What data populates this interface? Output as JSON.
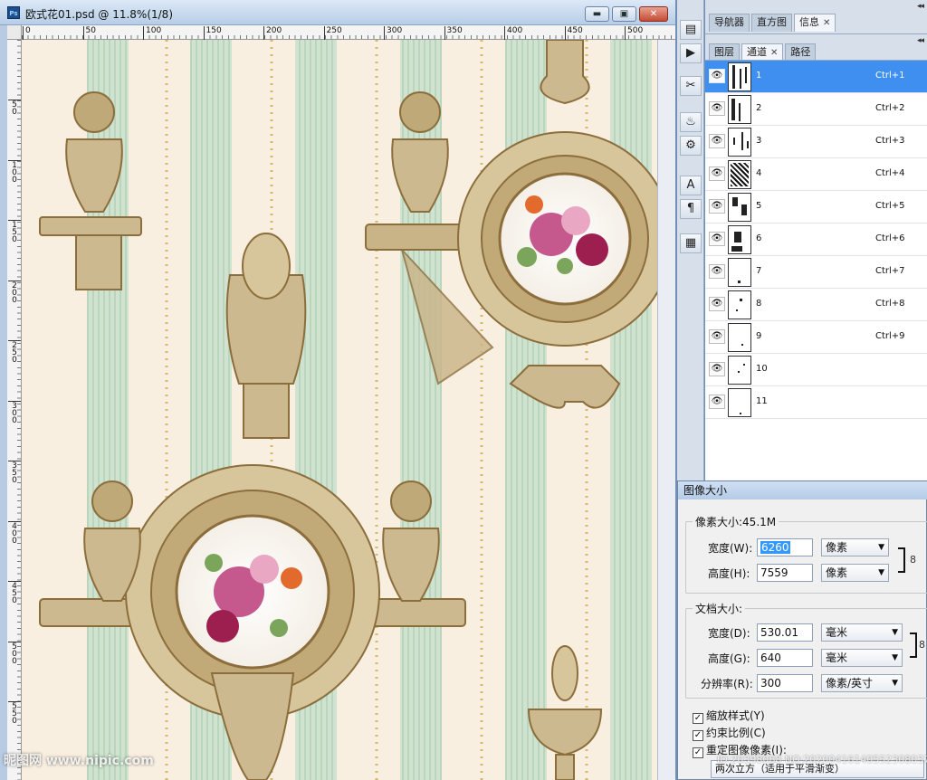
{
  "document": {
    "title": "欧式花01.psd @ 11.8%(1/8)",
    "app_badge": "Ps",
    "window_controls": {
      "minimize": "▬",
      "maximize": "▣",
      "close": "✕"
    },
    "ruler_top_ticks": [
      "0",
      "50",
      "100",
      "150",
      "200",
      "250",
      "300",
      "350",
      "400",
      "450",
      "500"
    ],
    "ruler_left_ticks": [
      "5\n0",
      "1\n0\n0",
      "1\n5\n0",
      "2\n0\n0",
      "2\n5\n0",
      "3\n0\n0",
      "3\n5\n0",
      "4\n0\n0",
      "4\n5\n0",
      "5\n0\n0",
      "5\n5\n0"
    ]
  },
  "panels": {
    "top_tabs": [
      {
        "label": "导航器"
      },
      {
        "label": "直方图"
      },
      {
        "label": "信息",
        "active": true
      }
    ],
    "mid_tabs": [
      {
        "label": "图层"
      },
      {
        "label": "通道",
        "active": true
      },
      {
        "label": "路径"
      }
    ],
    "close_glyph": "✕",
    "grip": "◂◂",
    "channels": [
      {
        "name": "1",
        "shortcut": "Ctrl+1",
        "selected": true
      },
      {
        "name": "2",
        "shortcut": "Ctrl+2"
      },
      {
        "name": "3",
        "shortcut": "Ctrl+3"
      },
      {
        "name": "4",
        "shortcut": "Ctrl+4"
      },
      {
        "name": "5",
        "shortcut": "Ctrl+5"
      },
      {
        "name": "6",
        "shortcut": "Ctrl+6"
      },
      {
        "name": "7",
        "shortcut": "Ctrl+7"
      },
      {
        "name": "8",
        "shortcut": "Ctrl+8"
      },
      {
        "name": "9",
        "shortcut": "Ctrl+9"
      },
      {
        "name": "10",
        "shortcut": ""
      },
      {
        "name": "11",
        "shortcut": ""
      }
    ],
    "eye_glyph": "👁"
  },
  "tools": [
    {
      "name": "history-brush-icon",
      "glyph": "▤"
    },
    {
      "name": "action-play-icon",
      "glyph": "▶"
    },
    {
      "name": "tools-icon",
      "glyph": "✂"
    },
    {
      "name": "clone-source-icon",
      "glyph": "♨"
    },
    {
      "name": "tool-presets-icon",
      "glyph": "⚙"
    },
    {
      "name": "character-icon",
      "glyph": "A"
    },
    {
      "name": "paragraph-icon",
      "glyph": "¶"
    },
    {
      "name": "layer-comps-icon",
      "glyph": "▦"
    }
  ],
  "image_size_dialog": {
    "title": "图像大小",
    "pixel_dimensions_label": "像素大小:45.1M",
    "width_label": "宽度(W):",
    "width_value": "6260",
    "height_label": "高度(H):",
    "height_value": "7559",
    "pixel_unit": "像素",
    "document_size_label": "文档大小:",
    "doc_width_label": "宽度(D):",
    "doc_width_value": "530.01",
    "doc_height_label": "高度(G):",
    "doc_height_value": "640",
    "mm_unit": "毫米",
    "resolution_label": "分辨率(R):",
    "resolution_value": "300",
    "resolution_unit": "像素/英寸",
    "scale_styles_label": "缩放样式(Y)",
    "constrain_label": "约束比例(C)",
    "resample_label": "重定图像像素(I):",
    "resample_method": "两次立方（适用于平滑渐变）",
    "check_glyph": "✓",
    "link_glyph": "8",
    "arrow_glyph": "▼"
  },
  "watermarks": {
    "left": "昵图网 www.nipic.com",
    "right": "ID:20398068 NO:20200416140552308037"
  }
}
